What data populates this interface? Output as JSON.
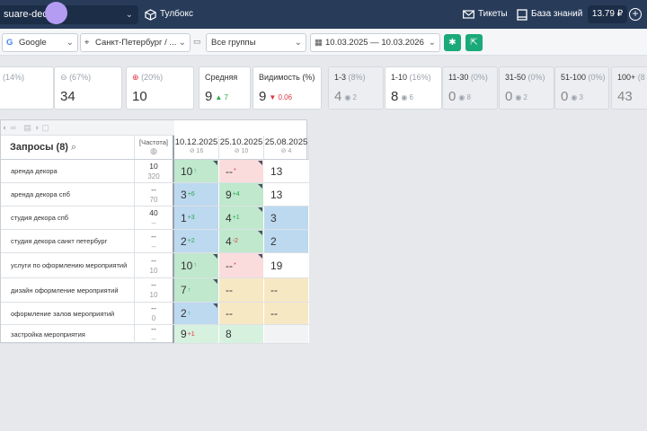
{
  "topbar": {
    "project": "suare-deco",
    "toolbox": "Тулбокс",
    "tickets": "Тикеты",
    "kb": "База знаний",
    "balance": "13.79 ₽"
  },
  "filters": {
    "engine": "Google",
    "region": "Санкт-Петербург / ...",
    "groups": "Все группы",
    "dates": "10.03.2025 — 10.03.2026"
  },
  "cards": [
    {
      "label": "",
      "pct": "(14%)",
      "value": "",
      "delta": ""
    },
    {
      "label": "",
      "pct": "(67%)",
      "value": "34",
      "delta": ""
    },
    {
      "label": "",
      "pct": "(20%)",
      "value": "10",
      "delta": ""
    },
    {
      "label": "Средняя",
      "pct": "",
      "value": "9",
      "delta": "7"
    },
    {
      "label": "Видимость (%)",
      "pct": "",
      "value": "9",
      "delta": "0.06"
    },
    {
      "label": "1-3",
      "pct": "(8%)",
      "value": "4",
      "delta": "2"
    },
    {
      "label": "1-10",
      "pct": "(16%)",
      "value": "8",
      "delta": "6"
    },
    {
      "label": "11-30",
      "pct": "(0%)",
      "value": "0",
      "delta": "8"
    },
    {
      "label": "31-50",
      "pct": "(0%)",
      "value": "0",
      "delta": "2"
    },
    {
      "label": "51-100",
      "pct": "(0%)",
      "value": "0",
      "delta": "3"
    },
    {
      "label": "100+",
      "pct": "(8",
      "value": "43",
      "delta": ""
    }
  ],
  "table": {
    "title": "Запросы",
    "count": "(8)",
    "freq": "[Частота]",
    "dates": [
      {
        "d": "10.12.2025",
        "n": "16"
      },
      {
        "d": "25.10.2025",
        "n": "10"
      },
      {
        "d": "25.08.2025",
        "n": "4"
      }
    ],
    "rows": [
      {
        "q": "аренда декора",
        "f1": "10",
        "f2": "320",
        "p": [
          {
            "v": "10",
            "s": "↑",
            "c": "g"
          },
          {
            "v": "--",
            "s": "*",
            "c": "r"
          },
          {
            "v": "13",
            "s": "",
            "c": ""
          }
        ]
      },
      {
        "q": "аренда декора спб",
        "f1": "--",
        "f2": "70",
        "p": [
          {
            "v": "3",
            "s": "+6",
            "c": "g"
          },
          {
            "v": "9",
            "s": "+4",
            "c": "g"
          },
          {
            "v": "13",
            "s": "",
            "c": ""
          }
        ]
      },
      {
        "q": "студия декора спб",
        "f1": "40",
        "f2": "--",
        "p": [
          {
            "v": "1",
            "s": "+3",
            "c": "g"
          },
          {
            "v": "4",
            "s": "+1",
            "c": "g"
          },
          {
            "v": "3",
            "s": "",
            "c": ""
          }
        ]
      },
      {
        "q": "студия декора санкт петербург",
        "f1": "--",
        "f2": "--",
        "p": [
          {
            "v": "2",
            "s": "+2",
            "c": "g"
          },
          {
            "v": "4",
            "s": "-2",
            "c": "r"
          },
          {
            "v": "2",
            "s": "",
            "c": ""
          }
        ]
      },
      {
        "q": "услуги по оформлению мероприятий",
        "f1": "--",
        "f2": "10",
        "p": [
          {
            "v": "10",
            "s": "↑",
            "c": "g"
          },
          {
            "v": "--",
            "s": "*",
            "c": "r"
          },
          {
            "v": "19",
            "s": "",
            "c": ""
          }
        ]
      },
      {
        "q": "дизайн оформление мероприятий",
        "f1": "--",
        "f2": "10",
        "p": [
          {
            "v": "7",
            "s": "↑",
            "c": "g"
          },
          {
            "v": "--",
            "s": "",
            "c": ""
          },
          {
            "v": "--",
            "s": "",
            "c": ""
          }
        ]
      },
      {
        "q": "оформление залов мероприятий",
        "f1": "--",
        "f2": "0",
        "p": [
          {
            "v": "2",
            "s": "↑",
            "c": "g"
          },
          {
            "v": "--",
            "s": "",
            "c": ""
          },
          {
            "v": "--",
            "s": "",
            "c": ""
          }
        ]
      },
      {
        "q": "застройка мероприятия",
        "f1": "--",
        "f2": "--",
        "p": [
          {
            "v": "9",
            "s": "+1",
            "c": "r"
          },
          {
            "v": "8",
            "s": "",
            "c": ""
          },
          {
            "v": "",
            "s": "",
            "c": ""
          }
        ]
      }
    ]
  }
}
